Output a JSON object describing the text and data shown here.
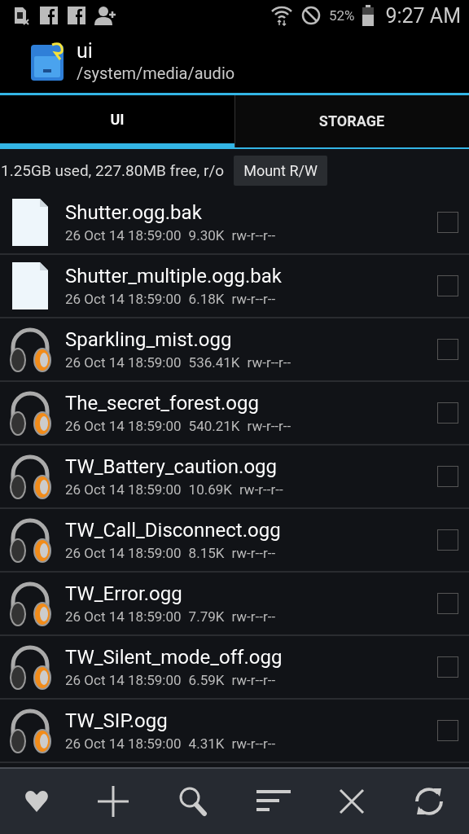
{
  "status_bar": {
    "battery": "52%",
    "time": "9:27 AM"
  },
  "header": {
    "title": "ui",
    "path": "/system/media/audio"
  },
  "tabs": [
    {
      "label": "UI",
      "selected": true
    },
    {
      "label": "STORAGE",
      "selected": false
    }
  ],
  "storage_info": {
    "text": "1.25GB used, 227.80MB free, r/o",
    "button": "Mount R/W"
  },
  "files": [
    {
      "kind": "file",
      "name": "Shutter.ogg.bak",
      "date": "26 Oct 14 18:59:00",
      "size": "9.30K",
      "perms": "rw-r--r--",
      "checked": false
    },
    {
      "kind": "file",
      "name": "Shutter_multiple.ogg.bak",
      "date": "26 Oct 14 18:59:00",
      "size": "6.18K",
      "perms": "rw-r--r--",
      "checked": false
    },
    {
      "kind": "audio",
      "name": "Sparkling_mist.ogg",
      "date": "26 Oct 14 18:59:00",
      "size": "536.41K",
      "perms": "rw-r--r--",
      "checked": false
    },
    {
      "kind": "audio",
      "name": "The_secret_forest.ogg",
      "date": "26 Oct 14 18:59:00",
      "size": "540.21K",
      "perms": "rw-r--r--",
      "checked": false
    },
    {
      "kind": "audio",
      "name": "TW_Battery_caution.ogg",
      "date": "26 Oct 14 18:59:00",
      "size": "10.69K",
      "perms": "rw-r--r--",
      "checked": false
    },
    {
      "kind": "audio",
      "name": "TW_Call_Disconnect.ogg",
      "date": "26 Oct 14 18:59:00",
      "size": "8.15K",
      "perms": "rw-r--r--",
      "checked": false
    },
    {
      "kind": "audio",
      "name": "TW_Error.ogg",
      "date": "26 Oct 14 18:59:00",
      "size": "7.79K",
      "perms": "rw-r--r--",
      "checked": false
    },
    {
      "kind": "audio",
      "name": "TW_Silent_mode_off.ogg",
      "date": "26 Oct 14 18:59:00",
      "size": "6.59K",
      "perms": "rw-r--r--",
      "checked": false
    },
    {
      "kind": "audio",
      "name": "TW_SIP.ogg",
      "date": "26 Oct 14 18:59:00",
      "size": "4.31K",
      "perms": "rw-r--r--",
      "checked": false
    }
  ]
}
